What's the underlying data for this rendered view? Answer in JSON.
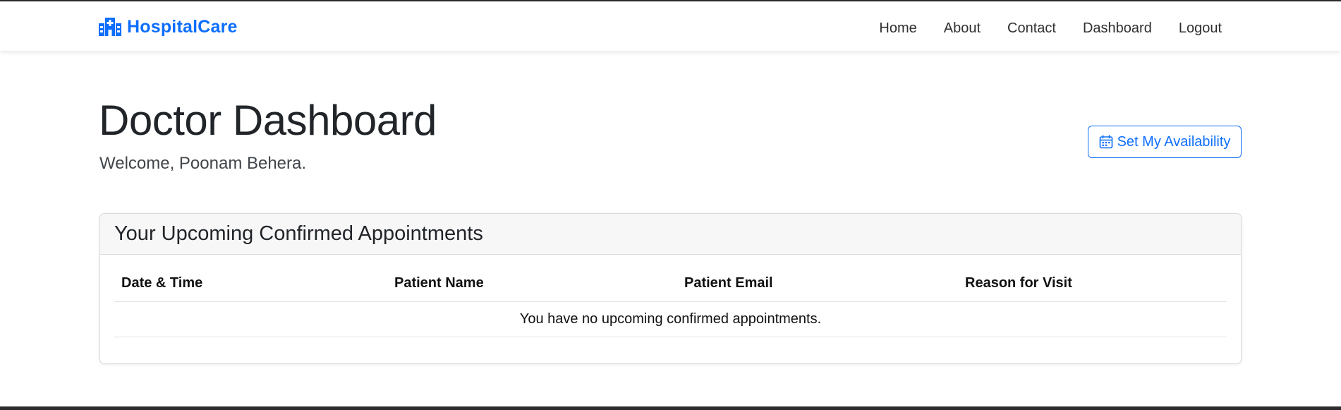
{
  "nav": {
    "brand_label": "HospitalCare",
    "links": [
      {
        "label": "Home"
      },
      {
        "label": "About"
      },
      {
        "label": "Contact"
      },
      {
        "label": "Dashboard"
      },
      {
        "label": "Logout"
      }
    ]
  },
  "header": {
    "title": "Doctor Dashboard",
    "welcome": "Welcome, Poonam Behera.",
    "availability_button": "Set My Availability"
  },
  "appointments": {
    "title": "Your Upcoming Confirmed Appointments",
    "columns": [
      "Date & Time",
      "Patient Name",
      "Patient Email",
      "Reason for Visit"
    ],
    "empty_message": "You have no upcoming confirmed appointments."
  },
  "colors": {
    "accent": "#0d6efd",
    "text": "#212529",
    "card_header_bg": "#f7f7f7"
  },
  "icons": {
    "brand": "hospital-icon",
    "availability": "calendar-icon"
  }
}
